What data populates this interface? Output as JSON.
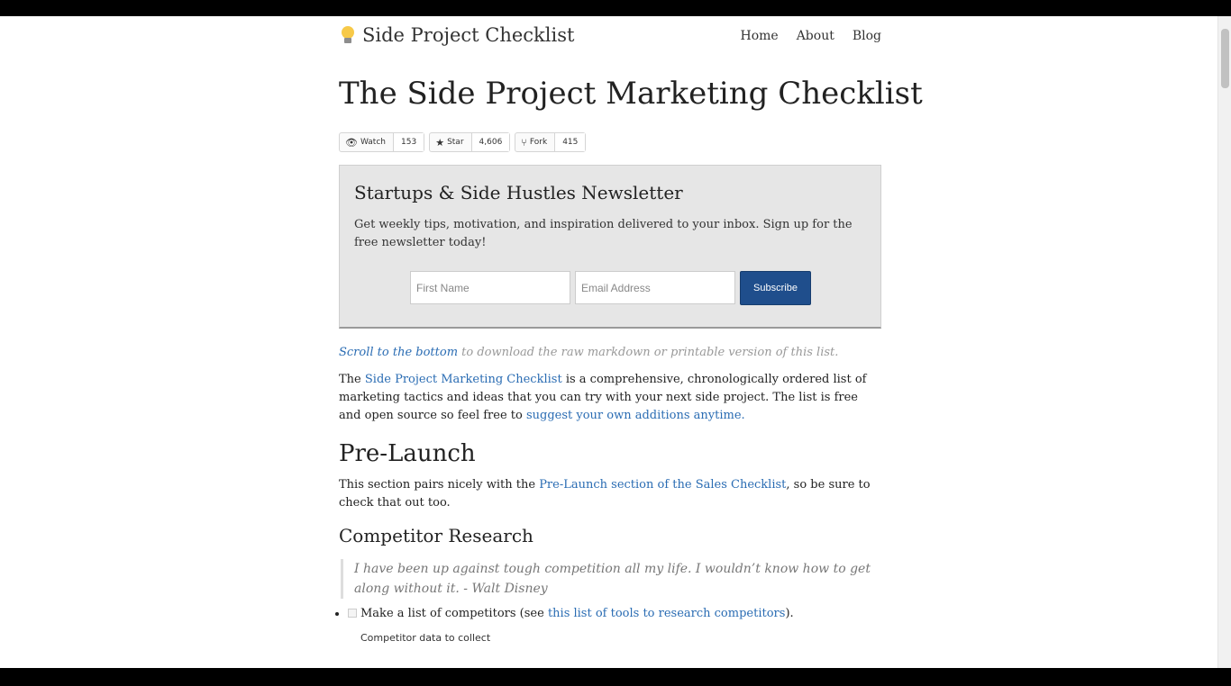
{
  "header": {
    "brand": "Side Project Checklist",
    "nav": [
      "Home",
      "About",
      "Blog"
    ]
  },
  "page_title": "The Side Project Marketing Checklist",
  "github": {
    "watch_label": "Watch",
    "watch_count": "153",
    "star_label": "Star",
    "star_count": "4,606",
    "fork_label": "Fork",
    "fork_count": "415"
  },
  "newsletter": {
    "title": "Startups & Side Hustles Newsletter",
    "description": "Get weekly tips, motivation, and inspiration delivered to your inbox. Sign up for the free newsletter today!",
    "first_name_placeholder": "First Name",
    "email_placeholder": "Email Address",
    "subscribe_label": "Subscribe"
  },
  "content": {
    "scroll_link": "Scroll to the bottom",
    "scroll_rest": " to download the raw markdown or printable version of this list.",
    "intro_prefix": "The ",
    "intro_link": "Side Project Marketing Checklist",
    "intro_middle": " is a comprehensive, chronologically ordered list of marketing tactics and ideas that you can try with your next side project. The list is free and open source so feel free to ",
    "intro_link2": "suggest your own additions anytime.",
    "section_title": "Pre-Launch",
    "pairs_prefix": "This section pairs nicely with the ",
    "pairs_link": "Pre-Launch section of the Sales Checklist",
    "pairs_suffix": ", so be sure to check that out too.",
    "subsection_title": "Competitor Research",
    "quote": "I have been up against tough competition all my life. I wouldn’t know how to get along without it. - Walt Disney",
    "task_prefix": "Make a list of competitors (see ",
    "task_link": "this list of tools to research competitors",
    "task_suffix": ").",
    "data_label": "Competitor data to collect"
  }
}
